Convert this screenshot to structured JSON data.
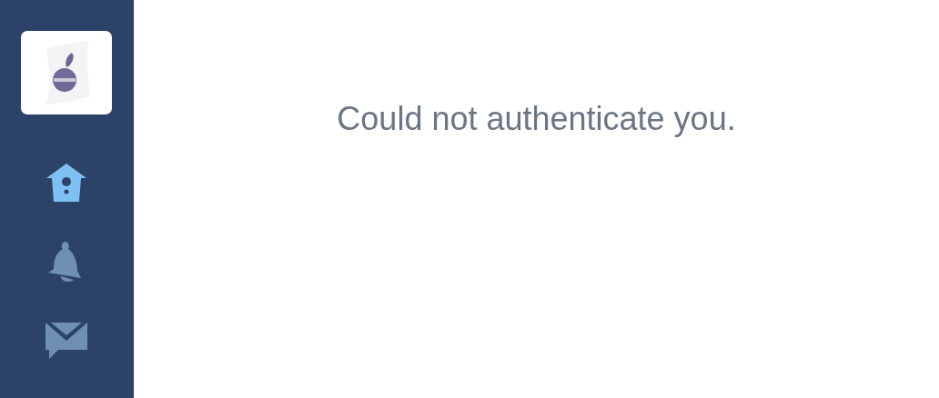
{
  "sidebar": {
    "items": [
      {
        "kind": "home",
        "selected": true
      },
      {
        "kind": "bell",
        "selected": false
      },
      {
        "kind": "mail",
        "selected": false
      }
    ]
  },
  "message": "Could not authenticate you."
}
